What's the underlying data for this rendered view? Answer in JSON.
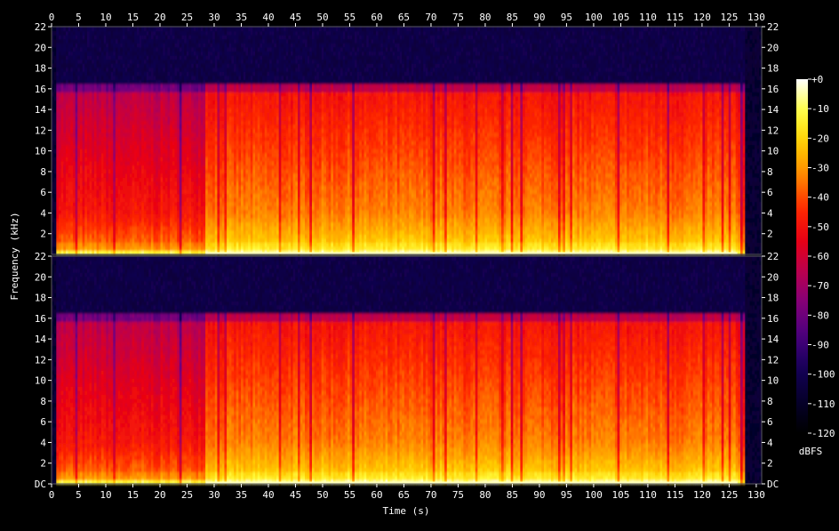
{
  "chart_data": {
    "type": "heatmap",
    "title": "",
    "xlabel": "Time (s)",
    "ylabel": "Frequency (kHz)",
    "xlim": [
      0,
      131
    ],
    "ylim": [
      0,
      22
    ],
    "x_ticks": [
      "0",
      "5",
      "10",
      "15",
      "20",
      "25",
      "30",
      "35",
      "40",
      "45",
      "50",
      "55",
      "60",
      "65",
      "70",
      "75",
      "80",
      "85",
      "90",
      "95",
      "100",
      "105",
      "110",
      "115",
      "120",
      "125",
      "130"
    ],
    "y_ticks": [
      "DC",
      "2",
      "4",
      "6",
      "8",
      "10",
      "12",
      "14",
      "16",
      "18",
      "20",
      "22"
    ],
    "channels": 2,
    "colorbar": {
      "label": "dBFS",
      "range": [
        -120,
        0
      ],
      "ticks": [
        "+0",
        "-10",
        "-20",
        "-30",
        "-40",
        "-50",
        "-60",
        "-70",
        "-80",
        "-90",
        "-100",
        "-110",
        "-120"
      ]
    },
    "colormap": [
      "#ffffff",
      "#ffff40",
      "#ffcc00",
      "#ff8800",
      "#ff2a00",
      "#e80014",
      "#b80050",
      "#80007a",
      "#48007e",
      "#140056",
      "#05002a",
      "#000000"
    ],
    "signal": {
      "music_start_s": 1,
      "music_end_s": 128,
      "cutoff_khz": 16.2,
      "quiet_intro_end_s": 28.5,
      "noise_floor_dbfs": -105
    }
  }
}
